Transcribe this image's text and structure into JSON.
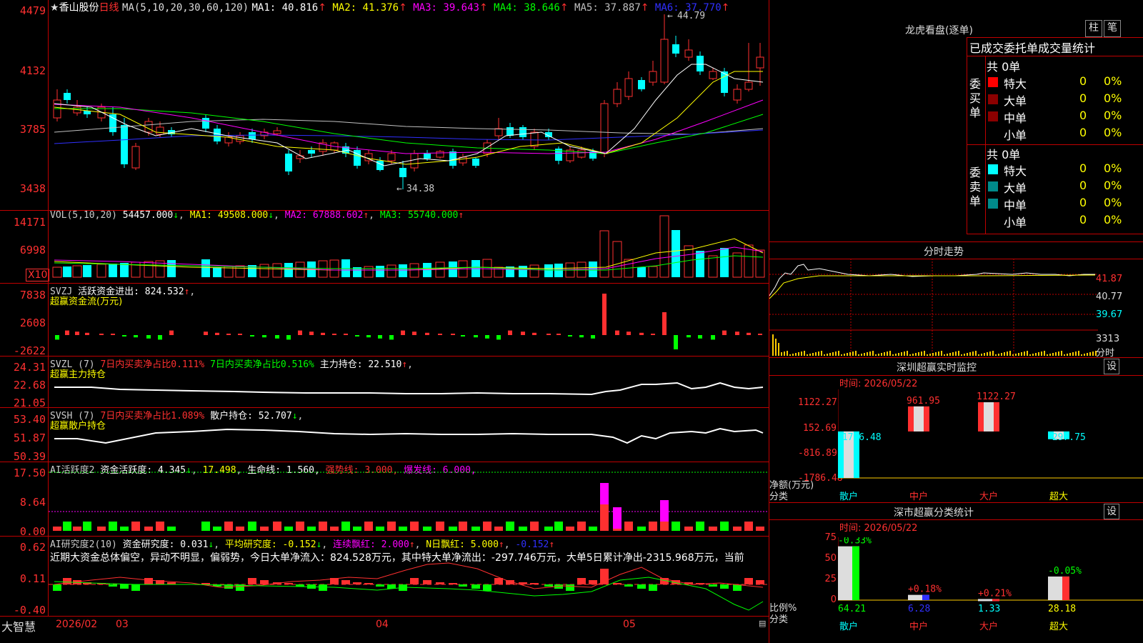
{
  "header": {
    "star": "★",
    "stock_name": "香山股份",
    "period": "日线",
    "ma_label": "MA(5,10,20,30,60,120)",
    "ma": [
      {
        "label": "MA1:",
        "value": "40.816",
        "arrow": "↑",
        "color": "#ffffff"
      },
      {
        "label": "MA2:",
        "value": "41.376",
        "arrow": "↑",
        "color": "#ffff00"
      },
      {
        "label": "MA3:",
        "value": "39.643",
        "arrow": "↑",
        "color": "#ff00ff"
      },
      {
        "label": "MA4:",
        "value": "38.646",
        "arrow": "↑",
        "color": "#00ff00"
      },
      {
        "label": "MA5:",
        "value": "37.887",
        "arrow": "↑",
        "color": "#c0c0c0"
      },
      {
        "label": "MA6:",
        "value": "37.770",
        "arrow": "↑",
        "color": "#3030ff"
      }
    ],
    "max_marker": "44.79",
    "min_marker": "34.38"
  },
  "price_axis": [
    "4479",
    "4132",
    "3785",
    "3438"
  ],
  "vol": {
    "title": "VOL(5,10,20)",
    "value": "54457.000",
    "value_arrow": "↓",
    "ma1": "MA1: 49508.000",
    "ma1_arrow": "↓",
    "ma2": "MA2: 67888.602",
    "ma2_arrow": "↑",
    "ma3": "MA3: 55740.000",
    "ma3_arrow": "↑",
    "axis": [
      "14171",
      "6998"
    ],
    "unit": "X10"
  },
  "svzj": {
    "title": "SVZJ",
    "label": "活跃资金进出:",
    "value": "824.532",
    "arrow": "↑",
    "comma": ",",
    "subtitle": "超赢资金流(万元)",
    "axis": [
      "7838",
      "2608",
      "-2622"
    ]
  },
  "svzl": {
    "title": "SVZL (7)",
    "a": "7日内买卖净占比0.111%",
    "b": "7日内买卖净占比0.516%",
    "c": "主力持仓: 22.510",
    "c_arrow": "↑",
    "comma": ",",
    "subtitle": "超赢主力持仓",
    "axis": [
      "24.31",
      "22.68",
      "21.05"
    ]
  },
  "svsh": {
    "title": "SVSH (7)",
    "a": "7日内买卖净占比1.089%",
    "b": "散户持仓: 52.707",
    "b_arrow": "↓",
    "comma": ",",
    "subtitle": "超赢散户持仓",
    "axis": [
      "53.40",
      "51.87",
      "50.39"
    ]
  },
  "ai": {
    "title": "AI活跃度2",
    "a": "资金活跃度: 4.345",
    "a_arrow": "↓",
    "b": "17.498",
    "c": "生命线: 1.560,",
    "d": "强势线: 3.000,",
    "e": "爆发线: 6.000,",
    "axis": [
      "17.50",
      "8.64",
      "0.00"
    ]
  },
  "research": {
    "title": "AI研究度2(10)",
    "a": "资金研究度: 0.031",
    "a_arrow": "↓",
    "b": "平均研究度: -0.152",
    "b_arrow": "↓",
    "c": "连续飘红: 2.000",
    "c_arrow": "↑",
    "d": "N日飘红: 5.000",
    "d_arrow": "↑",
    "e": "-0.152",
    "e_arrow": "↑",
    "text": "近期大资金总体偏空，异动不明显，偏弱势，今日大单净流入：824.528万元，其中特大单净流出：-297.746万元，大单5日累计净出-2315.968万元，当前",
    "axis": [
      "0.62",
      "0.11",
      "-0.40"
    ]
  },
  "bottom_bar": {
    "brand": "大智慧",
    "date": "2026/02",
    "m03": "03",
    "m04": "04",
    "m05": "05"
  },
  "right": {
    "tiger_title": "龙虎看盘(逐单)",
    "btn_zhu": "柱",
    "btn_bi": "笔",
    "tabs": "已成交委托单成交量统计",
    "buy_label": "委买单",
    "sell_label": "委卖单",
    "buy_total": "共 0单",
    "sell_total": "共 0单",
    "rows": [
      {
        "name": "特大",
        "count": "0",
        "pct": "0%"
      },
      {
        "name": "大单",
        "count": "0",
        "pct": "0%"
      },
      {
        "name": "中单",
        "count": "0",
        "pct": "0%"
      },
      {
        "name": "小单",
        "count": "0",
        "pct": "0%"
      }
    ],
    "intraday_title": "分时走势",
    "intraday_axis": [
      "41.87",
      "40.77",
      "39.67",
      "3313"
    ],
    "intraday_unit": "分时",
    "sz_title": "深圳超赢实时监控",
    "sz_btn": "设",
    "sz_time": "时间: 2026/05/22",
    "sz_axis": [
      "1122.27",
      "152.69",
      "-816.89",
      "-1786.48"
    ],
    "sz_netlabel": "净额(万元)",
    "sz_cat_label": "分类",
    "sz_values": [
      {
        "label": "-1786.48",
        "value": -1786.48
      },
      {
        "label": "961.95",
        "value": 961.95
      },
      {
        "label": "1122.27",
        "value": 1122.27
      },
      {
        "label": "-297.75",
        "value": -297.75
      }
    ],
    "categories": [
      "散户",
      "中户",
      "大户",
      "超大"
    ],
    "sc_title": "深市超赢分类统计",
    "sc_btn": "设",
    "sc_time": "时间: 2026/05/22",
    "sc_axis": [
      "75",
      "50",
      "25",
      "0"
    ],
    "sc_ratio_label": "比例%",
    "sc_cat_label": "分类",
    "sc_top": [
      "-0.33%",
      "+0.18%",
      "+0.21%",
      "-0.05%"
    ],
    "sc_values": [
      "64.21",
      "6.28",
      "1.33",
      "28.18"
    ]
  }
}
